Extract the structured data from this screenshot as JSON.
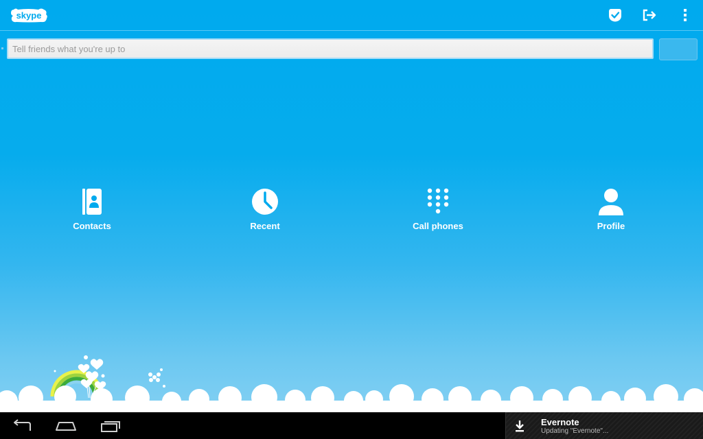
{
  "app": {
    "logo_text": "skype"
  },
  "header": {
    "icons": [
      "presence-available-icon",
      "sign-out-icon",
      "overflow-menu-icon"
    ]
  },
  "status": {
    "placeholder": "Tell friends what you're up to",
    "value": ""
  },
  "tiles": [
    {
      "label": "Contacts",
      "icon": "contacts-icon"
    },
    {
      "label": "Recent",
      "icon": "clock-icon"
    },
    {
      "label": "Call phones",
      "icon": "dialpad-icon"
    },
    {
      "label": "Profile",
      "icon": "person-icon"
    }
  ],
  "navbar": {
    "buttons": [
      "back-icon",
      "home-icon",
      "recent-apps-icon"
    ]
  },
  "notification": {
    "title": "Evernote",
    "subtitle": "Updating \"Evernote\"...",
    "icon": "download-icon"
  },
  "colors": {
    "background_top": "#00aaee",
    "background_bottom": "#8fd4f4",
    "tile_icon": "#ffffff",
    "navbar": "#000000"
  }
}
